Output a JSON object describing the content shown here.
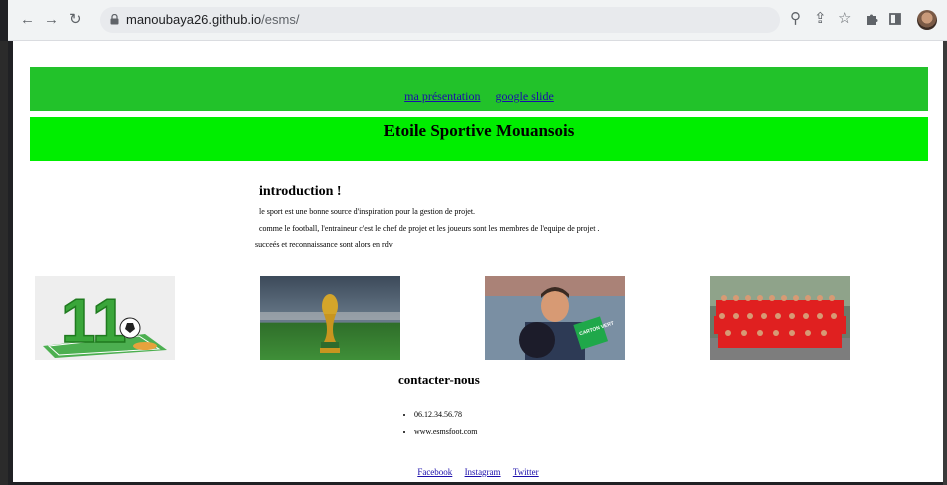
{
  "browser": {
    "url_host": "manoubaya26.github.io",
    "url_path": "/esms/",
    "icons": [
      "back-icon",
      "forward-icon",
      "reload-icon",
      "lock-icon",
      "zoom-icon",
      "share-icon",
      "star-icon",
      "extensions-icon",
      "sidepanel-icon",
      "profile-avatar",
      "menu-icon"
    ]
  },
  "nav": {
    "links": [
      "ma présentation",
      "google slide"
    ],
    "color": "#22c22a"
  },
  "header": {
    "title": "Etoile Sportive Mouansois",
    "color": "#00ee00"
  },
  "intro": {
    "heading": "introduction !",
    "lines": [
      "le sport est une bonne source d'inspiration pour la gestion de projet.",
      "comme le football, l'entraineur c'est le chef de projet et les joueurs sont les membres de l'equipe de projet .",
      "succeés et reconnaissance sont alors en rdv"
    ]
  },
  "photos": {
    "jersey_number": "11",
    "card_text": "CARTON VERT"
  },
  "contact": {
    "heading": "contacter-nous",
    "items": [
      "06.12.34.56.78",
      "www.esmsfoot.com"
    ]
  },
  "footer": {
    "links": [
      "Facebook",
      "Instagram",
      "Twitter"
    ]
  }
}
